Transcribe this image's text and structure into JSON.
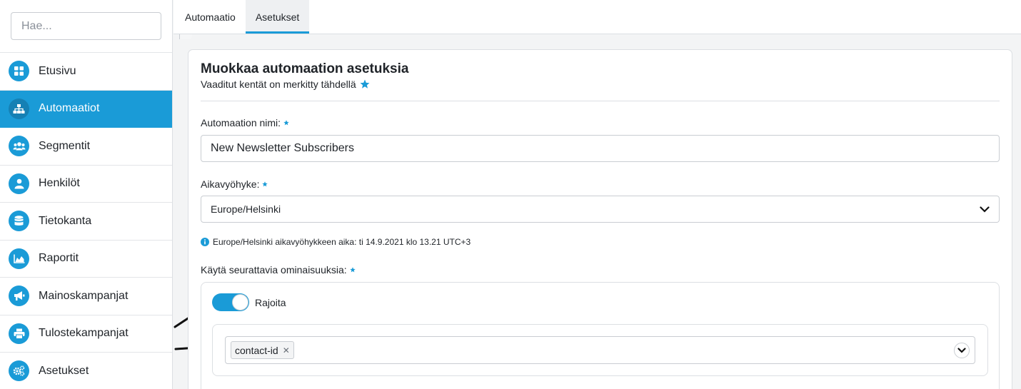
{
  "sidebar": {
    "search": {
      "placeholder": "Hae..."
    },
    "items": [
      {
        "label": "Etusivu",
        "icon": "dashboard-icon",
        "active": false
      },
      {
        "label": "Automaatiot",
        "icon": "sitemap-icon",
        "active": true
      },
      {
        "label": "Segmentit",
        "icon": "users-icon",
        "active": false
      },
      {
        "label": "Henkilöt",
        "icon": "user-icon",
        "active": false
      },
      {
        "label": "Tietokanta",
        "icon": "database-icon",
        "active": false
      },
      {
        "label": "Raportit",
        "icon": "area-chart-icon",
        "active": false
      },
      {
        "label": "Mainoskampanjat",
        "icon": "megaphone-icon",
        "active": false
      },
      {
        "label": "Tulostekampanjat",
        "icon": "printer-icon",
        "active": false
      },
      {
        "label": "Asetukset",
        "icon": "cogs-icon",
        "active": false
      }
    ]
  },
  "tabs": [
    {
      "label": "Automaatio",
      "active": false
    },
    {
      "label": "Asetukset",
      "active": true
    }
  ],
  "form": {
    "title": "Muokkaa automaation asetuksia",
    "subtitle": "Vaaditut kentät on merkitty tähdellä",
    "name_label": "Automaation nimi:",
    "name_value": "New Newsletter Subscribers",
    "timezone_label": "Aikavyöhyke:",
    "timezone_value": "Europe/Helsinki",
    "timezone_info": "Europe/Helsinki aikavyöhykkeen aika: ti 14.9.2021 klo 13.21 UTC+3",
    "features_label": "Käytä seurattavia ominaisuuksia:",
    "restrict_toggle": {
      "label": "Rajoita",
      "on": true
    },
    "restrict_tags": [
      "contact-id"
    ]
  },
  "colors": {
    "accent": "#1a9bd7",
    "border": "#c9cdd2",
    "background": "#f3f4f5"
  }
}
